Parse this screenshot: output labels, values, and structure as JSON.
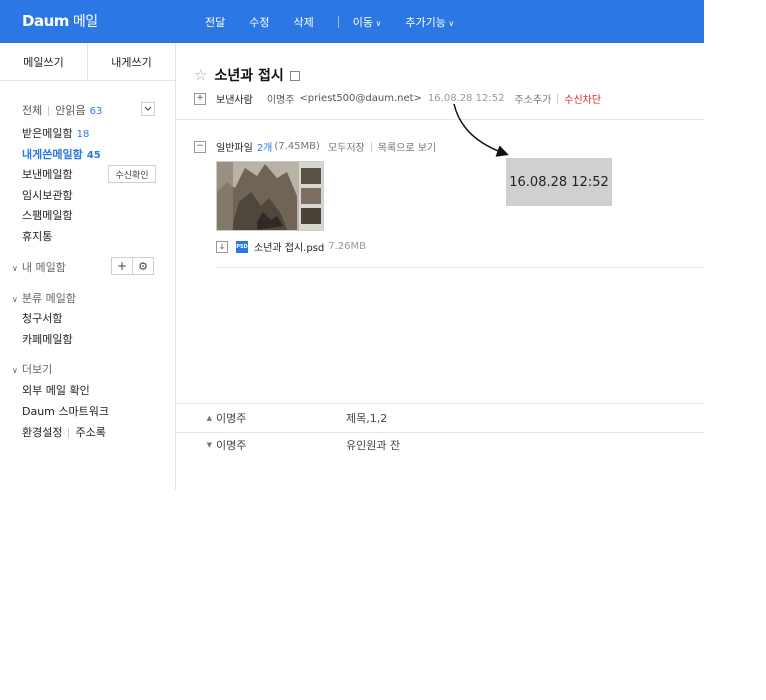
{
  "header": {
    "logo": "Daum",
    "service": "메일",
    "actions": [
      "전달",
      "수정",
      "삭제"
    ],
    "dropdowns": [
      "이동",
      "추가기능"
    ]
  },
  "sidebar": {
    "write": "메일쓰기",
    "write_self": "내게쓰기",
    "all": "전체",
    "unread_label": "안읽음",
    "unread_count": "63",
    "folders": [
      {
        "label": "받은메일함",
        "count": "18"
      },
      {
        "label": "내게쓴메일함",
        "count": "45"
      },
      {
        "label": "보낸메일함",
        "count": ""
      },
      {
        "label": "임시보관함",
        "count": ""
      },
      {
        "label": "스팸메일함",
        "count": ""
      },
      {
        "label": "휴지통",
        "count": ""
      }
    ],
    "receipt_check": "수신확인",
    "my_mailbox": "내 메일함",
    "category_mailbox": "분류 메일함",
    "category_items": [
      "청구서함",
      "카페메일함"
    ],
    "more": "더보기",
    "more_items": [
      "외부 메일 확인",
      "Daum 스마트워크"
    ],
    "settings": "환경설정",
    "address_book": "주소록"
  },
  "message": {
    "subject": "소년과 접시",
    "sender_label": "보낸사람",
    "sender_name": "이명주",
    "sender_email": "<priest500@daum.net>",
    "date": "16.08.28 12:52",
    "add_contact": "주소추가",
    "block": "수신차단",
    "attach_label": "일반파일",
    "attach_count": "2개",
    "attach_size": "(7.45MB)",
    "save_all": "모두저장",
    "list_view": "목록으로 보기",
    "file_name": "소년과 접시.psd",
    "file_size": "7.26MB",
    "file_type": "PSD"
  },
  "zoom_callout": "16.08.28 12:52",
  "nav_rows": [
    {
      "arrow": "▲",
      "name": "이명주",
      "subject": "제목,1,2"
    },
    {
      "arrow": "▼",
      "name": "이명주",
      "subject": "유인원과 잔"
    }
  ],
  "colors": {
    "accent": "#2b78e4",
    "block": "#dd2222"
  }
}
